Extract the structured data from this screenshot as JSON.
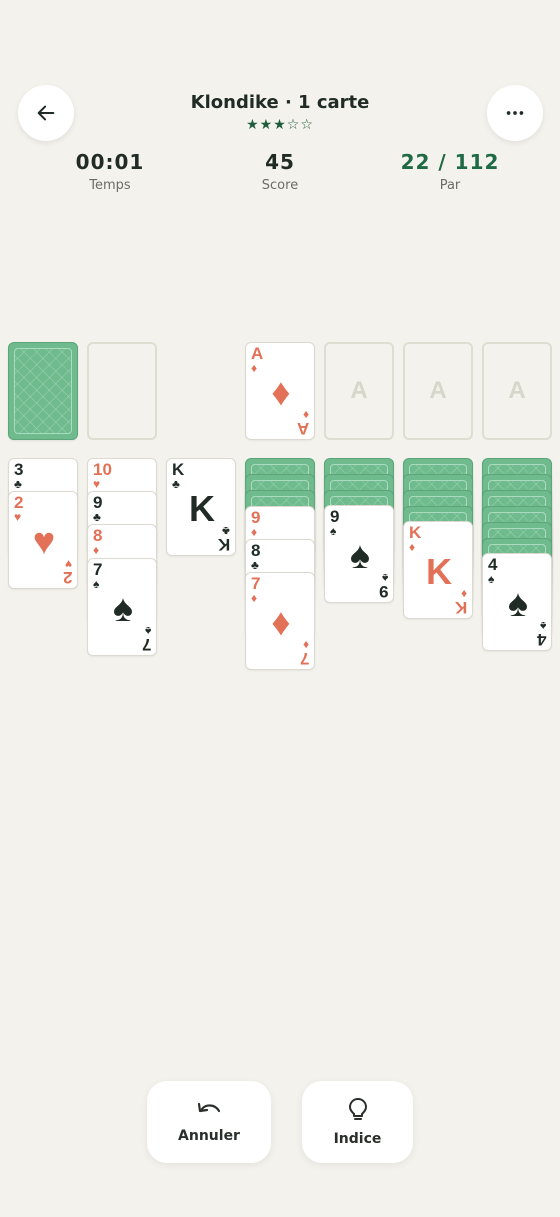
{
  "header": {
    "title": "Klondike · 1 carte",
    "stars_filled": "★★★",
    "stars_empty": "☆☆",
    "difficulty_stars": 3,
    "difficulty_max": 5
  },
  "stats": {
    "time_value": "00:01",
    "time_label": "Temps",
    "score_value": "45",
    "score_label": "Score",
    "par_value": "22 / 112",
    "par_label": "Par"
  },
  "top_row": {
    "waste_empty": true,
    "foundations": [
      {
        "rank": "A",
        "suit": "♦",
        "color": "red"
      },
      {
        "placeholder": "A"
      },
      {
        "placeholder": "A"
      },
      {
        "placeholder": "A"
      }
    ]
  },
  "tableau": {
    "col1": [
      {
        "rank": "3",
        "suit": "♣",
        "color": "black"
      },
      {
        "rank": "2",
        "suit": "♥",
        "color": "red"
      }
    ],
    "col2": [
      {
        "rank": "10",
        "suit": "♥",
        "color": "red"
      },
      {
        "rank": "9",
        "suit": "♣",
        "color": "black"
      },
      {
        "rank": "8",
        "suit": "♦",
        "color": "red"
      },
      {
        "rank": "7",
        "suit": "♠",
        "color": "black"
      }
    ],
    "col3": [
      {
        "rank": "K",
        "suit": "♣",
        "color": "black"
      }
    ],
    "col4": [
      {
        "rank": "9",
        "suit": "♦",
        "color": "red"
      },
      {
        "rank": "8",
        "suit": "♣",
        "color": "black"
      },
      {
        "rank": "7",
        "suit": "♦",
        "color": "red"
      }
    ],
    "col5": [
      {
        "rank": "9",
        "suit": "♠",
        "color": "black"
      }
    ],
    "col6": [
      {
        "rank": "K",
        "suit": "♦",
        "color": "red"
      }
    ],
    "col7": [
      {
        "rank": "4",
        "suit": "♠",
        "color": "black"
      }
    ]
  },
  "actions": {
    "undo_label": "Annuler",
    "hint_label": "Indice"
  },
  "colors": {
    "background": "#f4f2ec",
    "card_back": "#6fbb8e",
    "red_suit": "#e27157",
    "black_suit": "#1f2b24",
    "accent_green": "#1f6a45"
  }
}
